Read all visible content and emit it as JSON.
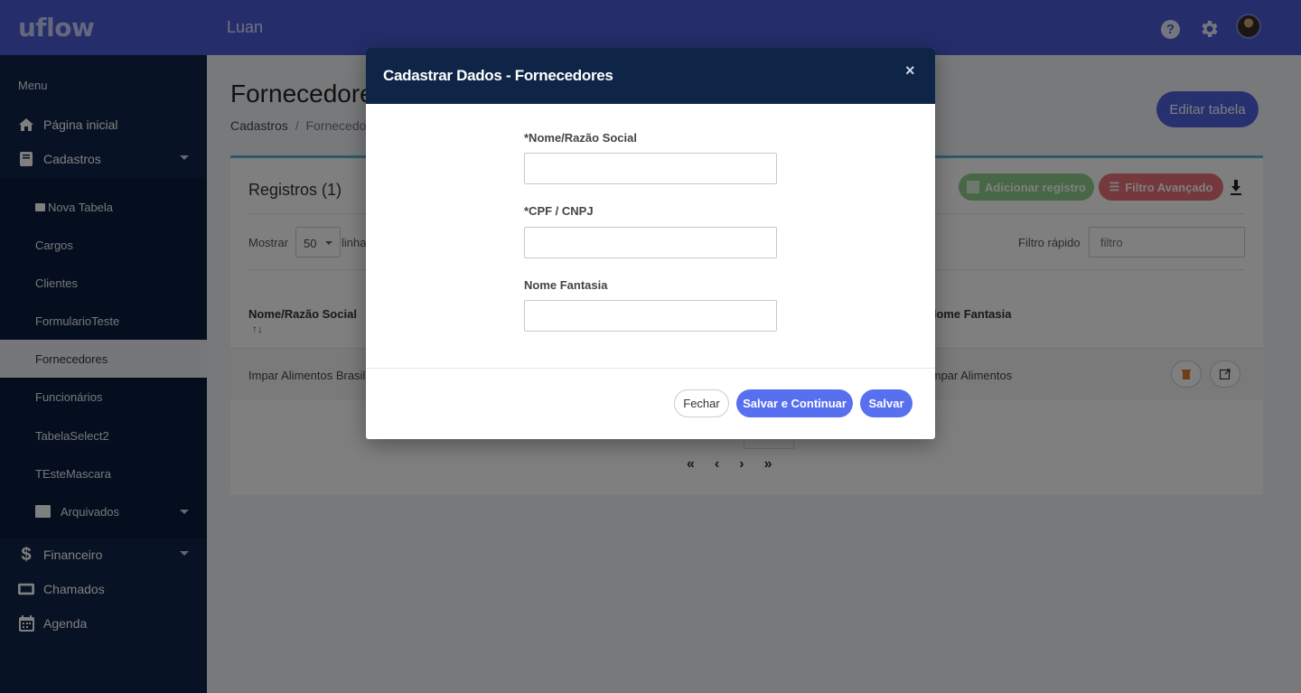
{
  "app": {
    "logo": "uflow",
    "user_name": "Luan"
  },
  "sidebar": {
    "menu_title": "Menu",
    "items": [
      {
        "label": "Página inicial",
        "icon": "home-icon"
      },
      {
        "label": "Cadastros",
        "icon": "book-icon",
        "expanded": true
      },
      {
        "label": "Financeiro",
        "icon": "dollar-icon"
      },
      {
        "label": "Chamados",
        "icon": "ticket-icon"
      },
      {
        "label": "Agenda",
        "icon": "calendar-icon"
      }
    ],
    "sub_items": [
      {
        "label": "Nova Tabela",
        "icon": "new-table-icon"
      },
      {
        "label": "Cargos"
      },
      {
        "label": "Clientes"
      },
      {
        "label": "FormularioTeste"
      },
      {
        "label": "Fornecedores",
        "active": true
      },
      {
        "label": "Funcionários"
      },
      {
        "label": "TabelaSelect2"
      },
      {
        "label": "TEsteMascara"
      },
      {
        "label": "Arquivados",
        "icon": "archive-icon"
      }
    ]
  },
  "page": {
    "title": "Fornecedores",
    "breadcrumb": [
      "Cadastros",
      "/",
      "Fornecedores"
    ],
    "edit_table_label": "Editar tabela"
  },
  "card": {
    "title": "Registros (1)",
    "add_label": "Adicionar registro",
    "filter_label": "Filtro Avançado",
    "show_label": "Mostrar",
    "show_value": "50",
    "show_after": "linhas",
    "quick_filter_label": "Filtro rápido",
    "quick_filter_placeholder": "filtro",
    "columns": [
      "Nome/Razão Social",
      "Nome Fantasia"
    ],
    "sort_arrows": "↑↓",
    "rows": [
      {
        "name": "Impar Alimentos Brasil",
        "fantasy": "Impar Alimentos"
      }
    ],
    "pager": [
      "«",
      "‹",
      "›",
      "»"
    ]
  },
  "modal": {
    "title": "Cadastrar Dados - Fornecedores",
    "close_glyph": "×",
    "fields": [
      {
        "label": "*Nome/Razão Social",
        "value": ""
      },
      {
        "label": "*CPF / CNPJ",
        "value": ""
      },
      {
        "label": "Nome Fantasia",
        "value": ""
      }
    ],
    "btn_close": "Fechar",
    "btn_save_continue": "Salvar e Continuar",
    "btn_save": "Salvar"
  },
  "colors": {
    "topbar": "#4a5bd4",
    "sidebar": "#0f2548",
    "modal_header": "#0f2548",
    "primary_button": "#5870f0",
    "add_button": "#8fcf8f",
    "filter_button": "#e8707a"
  }
}
